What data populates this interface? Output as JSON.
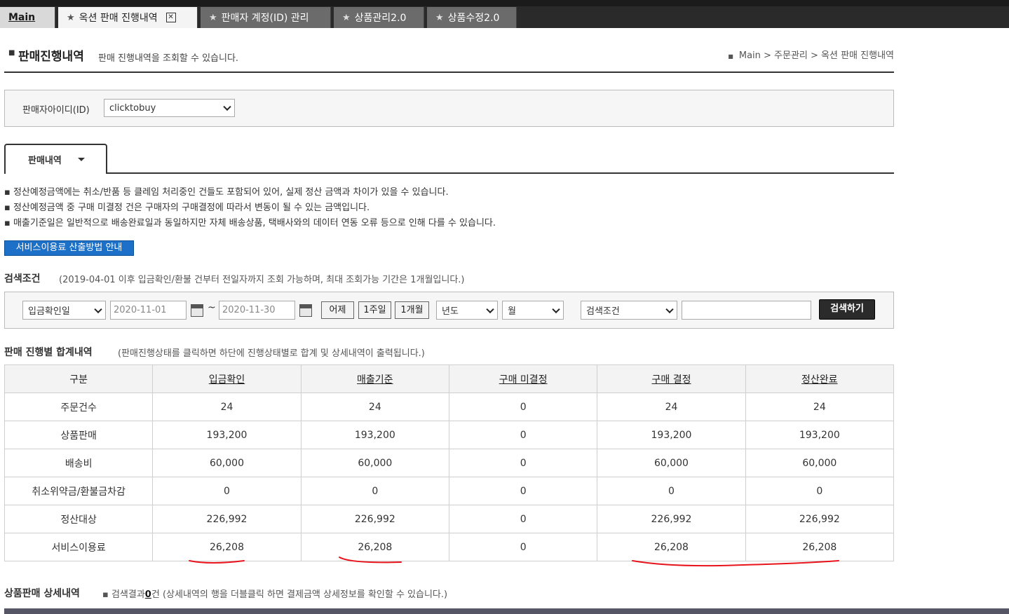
{
  "tabs": [
    {
      "label": "Main"
    },
    {
      "label": "옥션 판매 진행내역",
      "close": "✕"
    },
    {
      "label": "판매자 계정(ID) 관리"
    },
    {
      "label": "상품관리2.0"
    },
    {
      "label": "상품수정2.0"
    }
  ],
  "header": {
    "title": "판매진행내역",
    "description": "판매 진행내역을 조회할 수 있습니다.",
    "breadcrumb": "Main > 주문관리 > 옥션 판매 진행내역"
  },
  "seller": {
    "label": "판매자아이디(ID)",
    "value": "clicktobuy"
  },
  "subtab": {
    "label": "판매내역"
  },
  "notes": [
    "정산예정금액에는 취소/반품 등 클레임 처리중인 건들도 포함되어 있어, 실제 정산 금액과 차이가 있을 수 있습니다.",
    "정산예정금액 중 구매 미결정 건은 구매자의 구매결정에 따라서 변동이 될 수 있는 금액입니다.",
    "매출기준일은 일반적으로 배송완료일과 동일하지만 자체 배송상품, 택배사와의 데이터 연동 오류 등으로 인해 다를 수 있습니다."
  ],
  "service_fee_button": "서비스이용료 산출방법 안내",
  "search": {
    "title": "검색조건",
    "note": "(2019-04-01 이후 입금확인/환불 건부터 전일자까지 조회 가능하며, 최대 조회가능 기간은 1개월입니다.)",
    "date_type": "입금확인일",
    "start_date": "2020-11-01",
    "tilde": "~",
    "end_date": "2020-11-30",
    "btn_yesterday": "어제",
    "btn_week": "1주일",
    "btn_month": "1개월",
    "year": "년도",
    "month": "월",
    "condition": "검색조건",
    "keyword": "",
    "submit": "검색하기"
  },
  "summary": {
    "title": "판매 진행별 합계내역",
    "note": "(판매진행상태를 클릭하면 하단에 진행상태별로 합계 및 상세내역이 출력됩니다.)",
    "headers": [
      "구분",
      "입금확인",
      "매출기준",
      "구매 미결정",
      "구매 결정",
      "정산완료"
    ],
    "rows": [
      [
        "주문건수",
        "24",
        "24",
        "0",
        "24",
        "24"
      ],
      [
        "상품판매",
        "193,200",
        "193,200",
        "0",
        "193,200",
        "193,200"
      ],
      [
        "배송비",
        "60,000",
        "60,000",
        "0",
        "60,000",
        "60,000"
      ],
      [
        "취소위약금/환불금차감",
        "0",
        "0",
        "0",
        "0",
        "0"
      ],
      [
        "정산대상",
        "226,992",
        "226,992",
        "0",
        "226,992",
        "226,992"
      ],
      [
        "서비스이용료",
        "26,208",
        "26,208",
        "0",
        "26,208",
        "26,208"
      ]
    ]
  },
  "annotation_color": "#e8141c",
  "detail": {
    "title": "상품판매 상세내역",
    "result_prefix": "검색결과",
    "result_count": "0",
    "result_suffix": "건",
    "note": "(상세내역의 행을 더블클릭 하면 결제금액 상세정보를 확인할 수 있습니다.)"
  }
}
